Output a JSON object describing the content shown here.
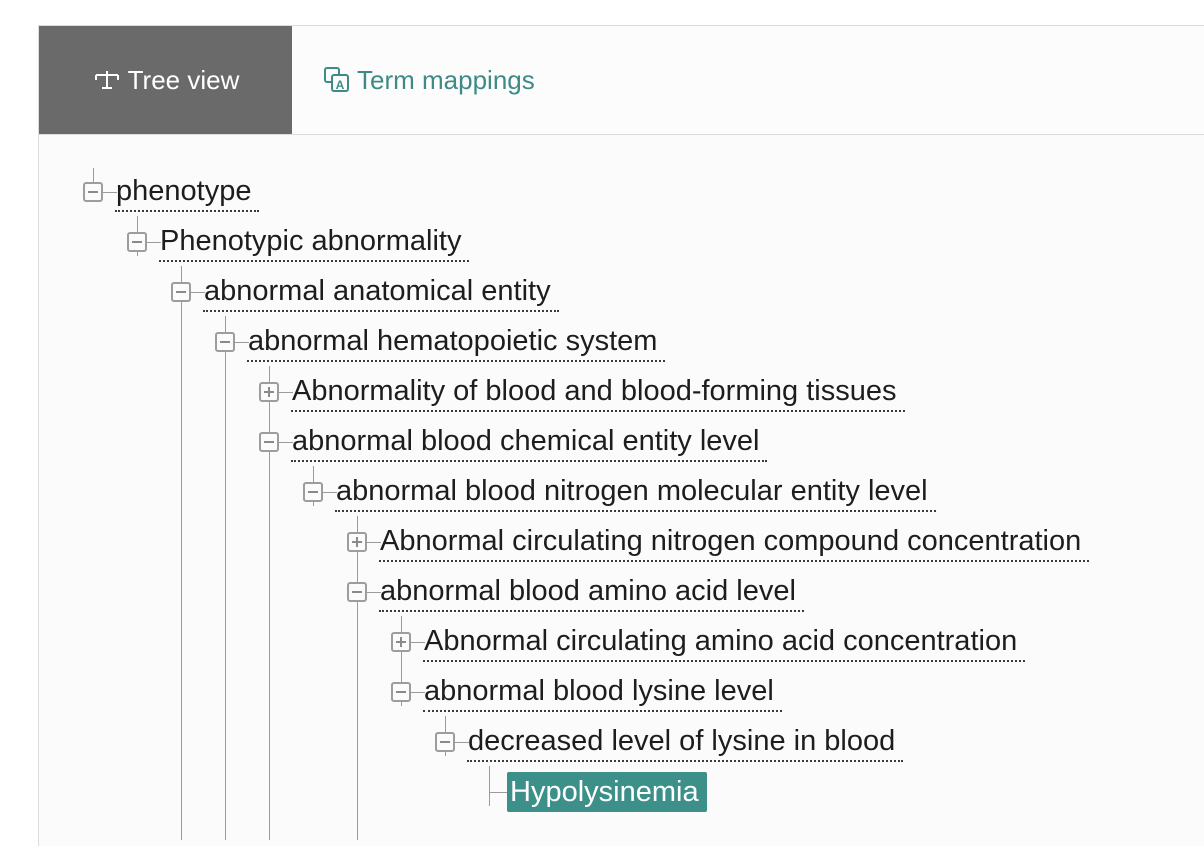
{
  "tabs": {
    "tree_view": "Tree view",
    "term_mappings": "Term mappings"
  },
  "colors": {
    "active_tab_bg": "#6a6a6a",
    "link": "#3d8a86",
    "selected_bg": "#3d908a"
  },
  "icons": {
    "tree_view": "tree-structure-icon",
    "term_mappings": "translate-mapping-icon"
  },
  "tree": {
    "nodes": [
      {
        "label": "phenotype",
        "level": 0,
        "toggle": "collapse"
      },
      {
        "label": "Phenotypic abnormality",
        "level": 1,
        "toggle": "collapse"
      },
      {
        "label": "abnormal anatomical entity",
        "level": 2,
        "toggle": "collapse"
      },
      {
        "label": "abnormal hematopoietic system",
        "level": 3,
        "toggle": "collapse"
      },
      {
        "label": "Abnormality of blood and blood-forming tissues",
        "level": 4,
        "toggle": "expand"
      },
      {
        "label": "abnormal blood chemical entity level",
        "level": 4,
        "toggle": "collapse"
      },
      {
        "label": "abnormal blood nitrogen molecular entity level",
        "level": 5,
        "toggle": "collapse"
      },
      {
        "label": "Abnormal circulating nitrogen compound concentration",
        "level": 6,
        "toggle": "expand"
      },
      {
        "label": "abnormal blood amino acid level",
        "level": 6,
        "toggle": "collapse"
      },
      {
        "label": "Abnormal circulating amino acid concentration",
        "level": 7,
        "toggle": "expand"
      },
      {
        "label": "abnormal blood lysine level",
        "level": 7,
        "toggle": "collapse"
      },
      {
        "label": "decreased level of lysine in blood",
        "level": 8,
        "toggle": "collapse"
      },
      {
        "label": "Hypolysinemia",
        "level": 9,
        "toggle": "none",
        "selected": true
      }
    ]
  }
}
